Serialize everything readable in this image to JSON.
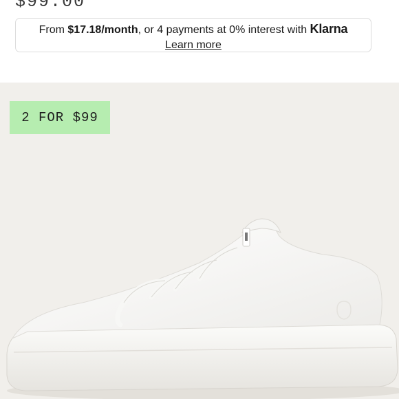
{
  "product": {
    "price": "$99.00"
  },
  "financing": {
    "prefix": "From ",
    "monthly_amount": "$17.18/month",
    "middle": ", or 4 payments at 0% interest with ",
    "provider": "Klarna",
    "learn_more": "Learn more"
  },
  "promo": {
    "badge_text": "2 FOR $99",
    "badge_color": "#b6edb0"
  },
  "image": {
    "background_color": "#f1efeb",
    "shoe_color": "#ffffff"
  }
}
